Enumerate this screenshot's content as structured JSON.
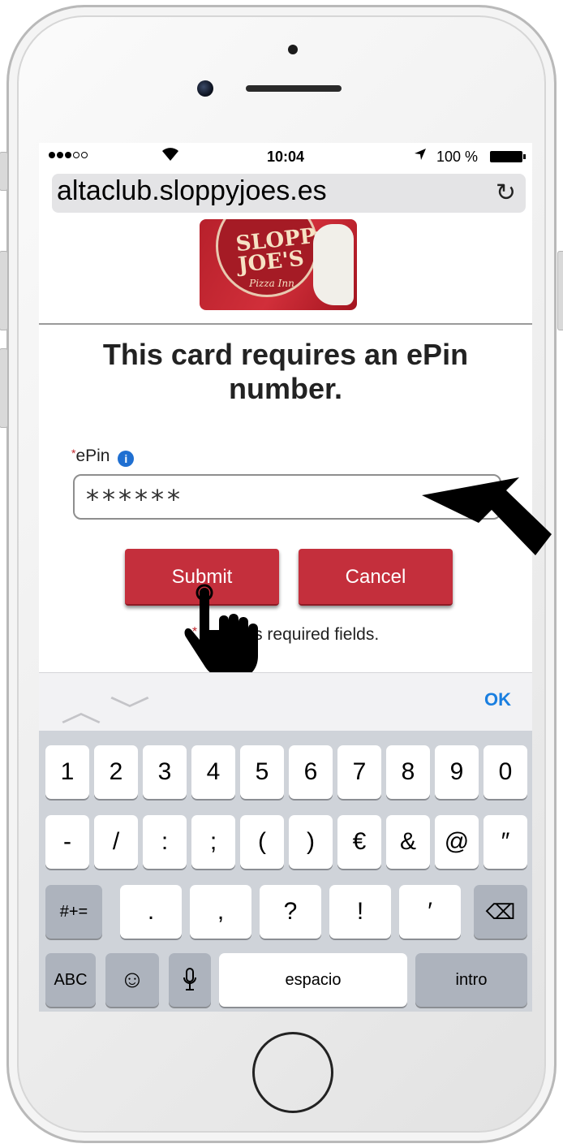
{
  "status_bar": {
    "time": "10:04",
    "battery": "100 %",
    "wifi_icon": "wifi-icon",
    "location_icon": "location-arrow-icon"
  },
  "browser": {
    "url": "altaclub.sloppyjoes.es",
    "reload_icon": "↻"
  },
  "card": {
    "logo_line1": "SLOPPy",
    "logo_line2": "JOE'S",
    "logo_sub": "Pizza Inn"
  },
  "page": {
    "heading": "This card requires an ePin number.",
    "field_required_mark": "*",
    "field_label": "ePin",
    "info_icon": "i",
    "pin_value": "******",
    "submit_label": "Submit",
    "cancel_label": "Cancel",
    "required_note_mark": "*",
    "required_note": "s required fields."
  },
  "keyboard_toolbar": {
    "prev_icon": "︿",
    "next_icon": "﹀",
    "ok_label": "OK"
  },
  "keyboard": {
    "row1": [
      "1",
      "2",
      "3",
      "4",
      "5",
      "6",
      "7",
      "8",
      "9",
      "0"
    ],
    "row2": [
      "-",
      "/",
      ":",
      ";",
      "(",
      ")",
      "€",
      "&",
      "@",
      "″"
    ],
    "row3_mode": "#+=",
    "row3": [
      ".",
      ",",
      "?",
      "!",
      "′"
    ],
    "backspace_icon": "⌫",
    "abc": "ABC",
    "emoji_icon": "☺",
    "mic_icon": "🎙",
    "space": "espacio",
    "return": "intro"
  }
}
